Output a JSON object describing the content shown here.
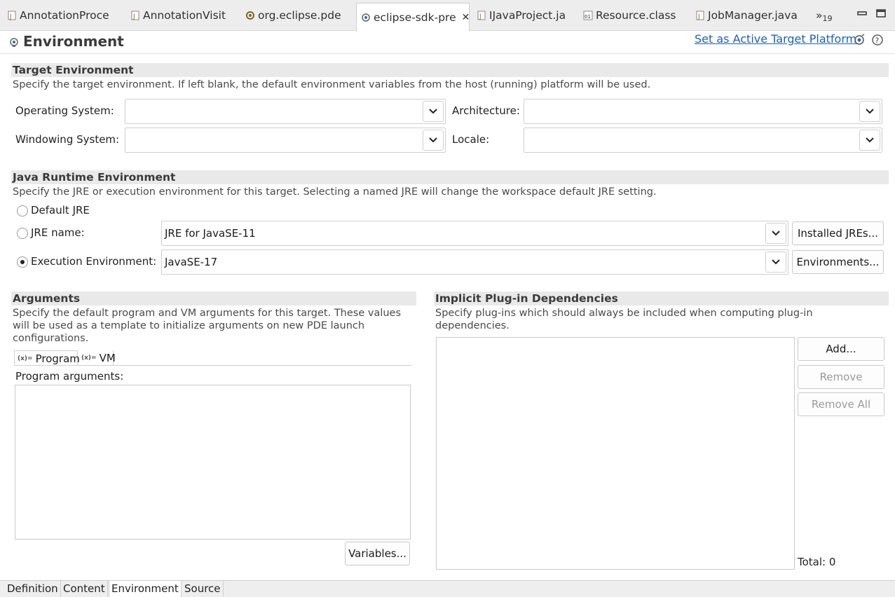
{
  "tabs": [
    {
      "label": "AnnotationProce",
      "icon": "java-file-icon"
    },
    {
      "label": "AnnotationVisit",
      "icon": "java-file-icon"
    },
    {
      "label": "org.eclipse.pde",
      "icon": "plugin-manifest-icon"
    },
    {
      "label": "eclipse-sdk-pre",
      "icon": "target-definition-icon",
      "active": true
    },
    {
      "label": "IJavaProject.ja",
      "icon": "java-file-icon"
    },
    {
      "label": "Resource.class",
      "icon": "class-file-icon"
    },
    {
      "label": "JobManager.java",
      "icon": "java-file-icon"
    }
  ],
  "tab_overflow": {
    "chevron": "»",
    "count": "19"
  },
  "header": {
    "title": "Environment",
    "set_active_link": "Set as Active Target Platform"
  },
  "target_env": {
    "heading": "Target Environment",
    "description": "Specify the target environment.  If left blank, the default environment variables from the host (running) platform will be used.",
    "os_label": "Operating System:",
    "os_value": "",
    "arch_label": "Architecture:",
    "arch_value": "",
    "ws_label": "Windowing System:",
    "ws_value": "",
    "locale_label": "Locale:",
    "locale_value": ""
  },
  "jre": {
    "heading": "Java Runtime Environment",
    "description": "Specify the JRE or execution environment for this target. Selecting a named JRE will change the workspace default JRE setting.",
    "default_label": "Default JRE",
    "name_label": "JRE name:",
    "name_value": "JRE for JavaSE-11",
    "installed_button": "Installed JREs...",
    "ee_label": "Execution Environment:",
    "ee_value": "JavaSE-17",
    "environments_button": "Environments...",
    "selected": "execution-environment"
  },
  "arguments": {
    "heading": "Arguments",
    "description": "Specify the default program and VM arguments for this target.  These values will be used as a template to initialize arguments on new PDE launch configurations.",
    "tab_program": "Program",
    "tab_vm": "VM",
    "program_args_label": "Program arguments:",
    "program_args_value": "",
    "variables_button": "Variables..."
  },
  "implicit": {
    "heading": "Implicit Plug-in Dependencies",
    "description": "Specify plug-ins which should always be included when computing plug-in dependencies.",
    "add_button": "Add...",
    "remove_button": "Remove",
    "remove_all_button": "Remove All",
    "total": "Total: 0"
  },
  "bottom_tabs": [
    "Definition",
    "Content",
    "Environment",
    "Source"
  ],
  "bottom_active": "Environment",
  "colors": {
    "link": "#1f5fb5",
    "section_bg": "#e9e9e9"
  }
}
